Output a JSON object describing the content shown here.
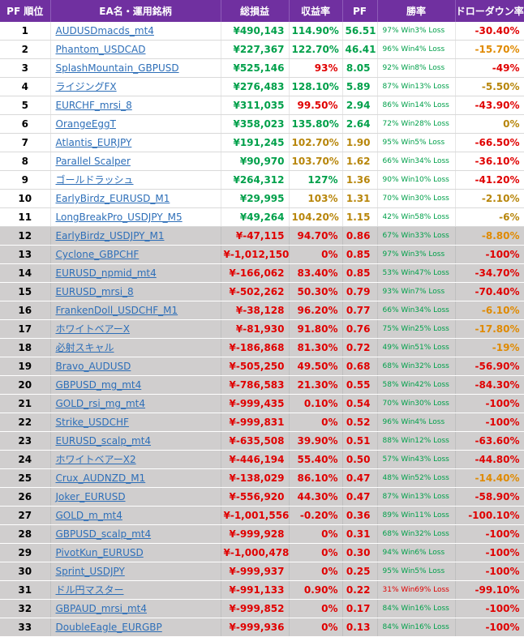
{
  "headers": [
    "PF 順位",
    "EA名・運用銘柄",
    "総損益",
    "収益率",
    "PF",
    "勝率",
    "ドローダウン率"
  ],
  "rows": [
    {
      "rank": "1",
      "name": "AUDUSDmacds_mt4",
      "profit": "¥490,143",
      "rate": "114.90%",
      "pf": "56.51",
      "win": "97% Win3% Loss",
      "dd": "-30.40%",
      "tier": "white",
      "pc": "green",
      "rc": "green",
      "pfc": "green",
      "wc": "ok",
      "dc": "red"
    },
    {
      "rank": "2",
      "name": "Phantom_USDCAD",
      "profit": "¥227,367",
      "rate": "122.70%",
      "pf": "46.41",
      "win": "96% Win4% Loss",
      "dd": "-15.70%",
      "tier": "white",
      "pc": "green",
      "rc": "green",
      "pfc": "green",
      "wc": "ok",
      "dc": "orange"
    },
    {
      "rank": "3",
      "name": "SplashMountain_GBPUSD",
      "profit": "¥525,146",
      "rate": "93%",
      "pf": "8.05",
      "win": "92% Win8% Loss",
      "dd": "-49%",
      "tier": "white",
      "pc": "green",
      "rc": "red",
      "pfc": "green",
      "wc": "ok",
      "dc": "red"
    },
    {
      "rank": "4",
      "name": "ライジングFX",
      "profit": "¥276,483",
      "rate": "128.10%",
      "pf": "5.89",
      "win": "87% Win13% Loss",
      "dd": "-5.50%",
      "tier": "white",
      "pc": "green",
      "rc": "green",
      "pfc": "green",
      "wc": "ok",
      "dc": "gold"
    },
    {
      "rank": "5",
      "name": "EURCHF_mrsi_8",
      "profit": "¥311,035",
      "rate": "99.50%",
      "pf": "2.94",
      "win": "86% Win14% Loss",
      "dd": "-43.90%",
      "tier": "white",
      "pc": "green",
      "rc": "red",
      "pfc": "green",
      "wc": "ok",
      "dc": "red"
    },
    {
      "rank": "6",
      "name": "OrangeEggT",
      "profit": "¥358,023",
      "rate": "135.80%",
      "pf": "2.64",
      "win": "72% Win28% Loss",
      "dd": "0%",
      "tier": "white",
      "pc": "green",
      "rc": "green",
      "pfc": "green",
      "wc": "ok",
      "dc": "gold"
    },
    {
      "rank": "7",
      "name": "Atlantis_EURJPY",
      "profit": "¥191,245",
      "rate": "102.70%",
      "pf": "1.90",
      "win": "95% Win5% Loss",
      "dd": "-66.50%",
      "tier": "white",
      "pc": "green",
      "rc": "gold",
      "pfc": "gold",
      "wc": "ok",
      "dc": "red"
    },
    {
      "rank": "8",
      "name": "Parallel Scalper",
      "profit": "¥90,970",
      "rate": "103.70%",
      "pf": "1.62",
      "win": "66% Win34% Loss",
      "dd": "-36.10%",
      "tier": "white",
      "pc": "green",
      "rc": "gold",
      "pfc": "gold",
      "wc": "ok",
      "dc": "red"
    },
    {
      "rank": "9",
      "name": "ゴールドラッシュ",
      "profit": "¥264,312",
      "rate": "127%",
      "pf": "1.36",
      "win": "90% Win10% Loss",
      "dd": "-41.20%",
      "tier": "white",
      "pc": "green",
      "rc": "green",
      "pfc": "gold",
      "wc": "ok",
      "dc": "red"
    },
    {
      "rank": "10",
      "name": "EarlyBirdz_EURUSD_M1",
      "profit": "¥29,995",
      "rate": "103%",
      "pf": "1.31",
      "win": "70% Win30% Loss",
      "dd": "-2.10%",
      "tier": "white",
      "pc": "green",
      "rc": "gold",
      "pfc": "gold",
      "wc": "ok",
      "dc": "gold"
    },
    {
      "rank": "11",
      "name": "LongBreakPro_USDJPY_M5",
      "profit": "¥49,264",
      "rate": "104.20%",
      "pf": "1.15",
      "win": "42% Win58% Loss",
      "dd": "-6%",
      "tier": "white",
      "pc": "green",
      "rc": "gold",
      "pfc": "gold",
      "wc": "ok",
      "dc": "gold"
    },
    {
      "rank": "12",
      "name": "EarlyBirdz_USDJPY_M1",
      "profit": "¥-47,115",
      "rate": "94.70%",
      "pf": "0.86",
      "win": "67% Win33% Loss",
      "dd": "-8.80%",
      "tier": "grey",
      "pc": "red",
      "rc": "red",
      "pfc": "red",
      "wc": "ok",
      "dc": "orange"
    },
    {
      "rank": "13",
      "name": "Cyclone_GBPCHF",
      "profit": "¥-1,012,150",
      "rate": "0%",
      "pf": "0.85",
      "win": "97% Win3% Loss",
      "dd": "-100%",
      "tier": "grey",
      "pc": "red",
      "rc": "red",
      "pfc": "red",
      "wc": "ok",
      "dc": "red"
    },
    {
      "rank": "14",
      "name": "EURUSD_npmid_mt4",
      "profit": "¥-166,062",
      "rate": "83.40%",
      "pf": "0.85",
      "win": "53% Win47% Loss",
      "dd": "-34.70%",
      "tier": "grey",
      "pc": "red",
      "rc": "red",
      "pfc": "red",
      "wc": "ok",
      "dc": "red"
    },
    {
      "rank": "15",
      "name": "EURUSD_mrsi_8",
      "profit": "¥-502,262",
      "rate": "50.30%",
      "pf": "0.79",
      "win": "93% Win7% Loss",
      "dd": "-70.40%",
      "tier": "grey",
      "pc": "red",
      "rc": "red",
      "pfc": "red",
      "wc": "ok",
      "dc": "red"
    },
    {
      "rank": "16",
      "name": "FrankenDoll_USDCHF_M1",
      "profit": "¥-38,128",
      "rate": "96.20%",
      "pf": "0.77",
      "win": "66% Win34% Loss",
      "dd": "-6.10%",
      "tier": "grey",
      "pc": "red",
      "rc": "red",
      "pfc": "red",
      "wc": "ok",
      "dc": "orange"
    },
    {
      "rank": "17",
      "name": "ホワイトベアーX",
      "profit": "¥-81,930",
      "rate": "91.80%",
      "pf": "0.76",
      "win": "75% Win25% Loss",
      "dd": "-17.80%",
      "tier": "grey",
      "pc": "red",
      "rc": "red",
      "pfc": "red",
      "wc": "ok",
      "dc": "orange"
    },
    {
      "rank": "18",
      "name": "必射スキャル",
      "profit": "¥-186,868",
      "rate": "81.30%",
      "pf": "0.72",
      "win": "49% Win51% Loss",
      "dd": "-19%",
      "tier": "grey",
      "pc": "red",
      "rc": "red",
      "pfc": "red",
      "wc": "ok",
      "dc": "orange"
    },
    {
      "rank": "19",
      "name": "Bravo_AUDUSD",
      "profit": "¥-505,250",
      "rate": "49.50%",
      "pf": "0.68",
      "win": "68% Win32% Loss",
      "dd": "-56.90%",
      "tier": "grey",
      "pc": "red",
      "rc": "red",
      "pfc": "red",
      "wc": "ok",
      "dc": "red"
    },
    {
      "rank": "20",
      "name": "GBPUSD_mg_mt4",
      "profit": "¥-786,583",
      "rate": "21.30%",
      "pf": "0.55",
      "win": "58% Win42% Loss",
      "dd": "-84.30%",
      "tier": "grey",
      "pc": "red",
      "rc": "red",
      "pfc": "red",
      "wc": "ok",
      "dc": "red"
    },
    {
      "rank": "21",
      "name": "GOLD_rsi_mg_mt4",
      "profit": "¥-999,435",
      "rate": "0.10%",
      "pf": "0.54",
      "win": "70% Win30% Loss",
      "dd": "-100%",
      "tier": "grey",
      "pc": "red",
      "rc": "red",
      "pfc": "red",
      "wc": "ok",
      "dc": "red"
    },
    {
      "rank": "22",
      "name": "Strike_USDCHF",
      "profit": "¥-999,831",
      "rate": "0%",
      "pf": "0.52",
      "win": "96% Win4% Loss",
      "dd": "-100%",
      "tier": "grey",
      "pc": "red",
      "rc": "red",
      "pfc": "red",
      "wc": "ok",
      "dc": "red"
    },
    {
      "rank": "23",
      "name": "EURUSD_scalp_mt4",
      "profit": "¥-635,508",
      "rate": "39.90%",
      "pf": "0.51",
      "win": "88% Win12% Loss",
      "dd": "-63.60%",
      "tier": "grey",
      "pc": "red",
      "rc": "red",
      "pfc": "red",
      "wc": "ok",
      "dc": "red"
    },
    {
      "rank": "24",
      "name": "ホワイトベアーX2",
      "profit": "¥-446,194",
      "rate": "55.40%",
      "pf": "0.50",
      "win": "57% Win43% Loss",
      "dd": "-44.80%",
      "tier": "grey",
      "pc": "red",
      "rc": "red",
      "pfc": "red",
      "wc": "ok",
      "dc": "red"
    },
    {
      "rank": "25",
      "name": "Crux_AUDNZD_M1",
      "profit": "¥-138,029",
      "rate": "86.10%",
      "pf": "0.47",
      "win": "48% Win52% Loss",
      "dd": "-14.40%",
      "tier": "grey",
      "pc": "red",
      "rc": "red",
      "pfc": "red",
      "wc": "ok",
      "dc": "orange"
    },
    {
      "rank": "26",
      "name": "Joker_EURUSD",
      "profit": "¥-556,920",
      "rate": "44.30%",
      "pf": "0.47",
      "win": "87% Win13% Loss",
      "dd": "-58.90%",
      "tier": "grey",
      "pc": "red",
      "rc": "red",
      "pfc": "red",
      "wc": "ok",
      "dc": "red"
    },
    {
      "rank": "27",
      "name": "GOLD_m_mt4",
      "profit": "¥-1,001,556",
      "rate": "-0.20%",
      "pf": "0.36",
      "win": "89% Win11% Loss",
      "dd": "-100.10%",
      "tier": "grey",
      "pc": "red",
      "rc": "red",
      "pfc": "red",
      "wc": "ok",
      "dc": "red"
    },
    {
      "rank": "28",
      "name": "GBPUSD_scalp_mt4",
      "profit": "¥-999,928",
      "rate": "0%",
      "pf": "0.31",
      "win": "68% Win32% Loss",
      "dd": "-100%",
      "tier": "grey",
      "pc": "red",
      "rc": "red",
      "pfc": "red",
      "wc": "ok",
      "dc": "red"
    },
    {
      "rank": "29",
      "name": "PivotKun_EURUSD",
      "profit": "¥-1,000,478",
      "rate": "0%",
      "pf": "0.30",
      "win": "94% Win6% Loss",
      "dd": "-100%",
      "tier": "grey",
      "pc": "red",
      "rc": "red",
      "pfc": "red",
      "wc": "ok",
      "dc": "red"
    },
    {
      "rank": "30",
      "name": "Sprint_USDJPY",
      "profit": "¥-999,937",
      "rate": "0%",
      "pf": "0.25",
      "win": "95% Win5% Loss",
      "dd": "-100%",
      "tier": "grey",
      "pc": "red",
      "rc": "red",
      "pfc": "red",
      "wc": "ok",
      "dc": "red"
    },
    {
      "rank": "31",
      "name": "ドル円マスター",
      "profit": "¥-991,133",
      "rate": "0.90%",
      "pf": "0.22",
      "win": "31% Win69% Loss",
      "dd": "-99.10%",
      "tier": "grey",
      "pc": "red",
      "rc": "red",
      "pfc": "red",
      "wc": "bad",
      "dc": "red"
    },
    {
      "rank": "32",
      "name": "GBPAUD_mrsi_mt4",
      "profit": "¥-999,852",
      "rate": "0%",
      "pf": "0.17",
      "win": "84% Win16% Loss",
      "dd": "-100%",
      "tier": "grey",
      "pc": "red",
      "rc": "red",
      "pfc": "red",
      "wc": "ok",
      "dc": "red"
    },
    {
      "rank": "33",
      "name": "DoubleEagle_EURGBP",
      "profit": "¥-999,936",
      "rate": "0%",
      "pf": "0.13",
      "win": "84% Win16% Loss",
      "dd": "-100%",
      "tier": "grey",
      "pc": "red",
      "rc": "red",
      "pfc": "red",
      "wc": "ok",
      "dc": "red"
    }
  ]
}
